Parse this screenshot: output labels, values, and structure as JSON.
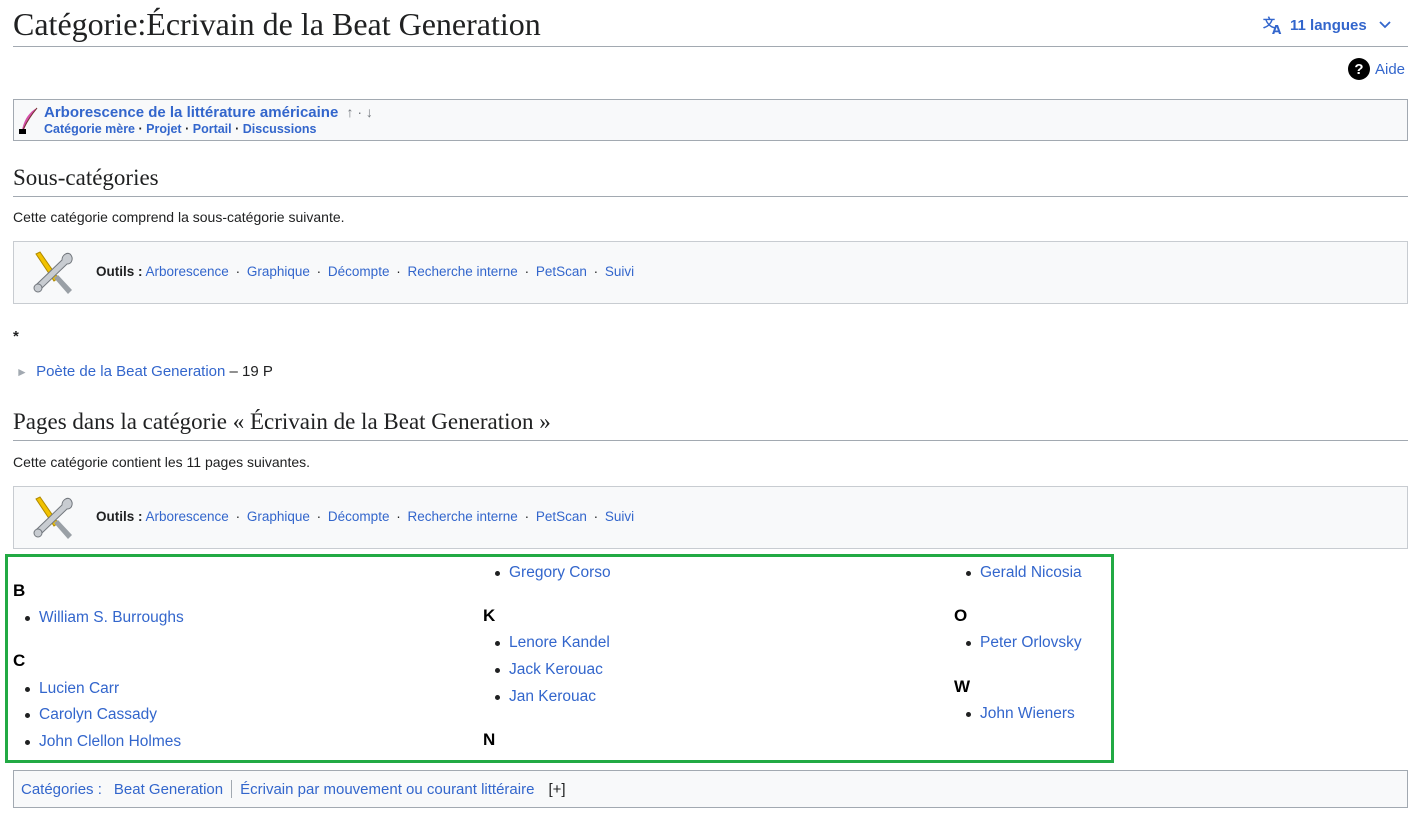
{
  "header": {
    "title": "Catégorie:Écrivain de la Beat Generation",
    "languages_label": "11 langues",
    "help_label": "Aide",
    "help_icon_glyph": "?"
  },
  "tree": {
    "main_link": "Arborescence de la littérature américaine",
    "arrows": "↑ · ↓",
    "sub_links": [
      "Catégorie mère",
      "Projet",
      "Portail",
      "Discussions"
    ],
    "separator": "·"
  },
  "subcategories": {
    "heading": "Sous-catégories",
    "description": "Cette catégorie comprend la sous-catégorie suivante.",
    "star": "*",
    "items": [
      {
        "label": "Poète de la Beat Generation",
        "count": "– 19 P"
      }
    ]
  },
  "tools": {
    "label": "Outils :",
    "links": [
      "Arborescence",
      "Graphique",
      "Décompte",
      "Recherche interne",
      "PetScan",
      "Suivi"
    ],
    "separator": "·"
  },
  "pages": {
    "heading": "Pages dans la catégorie « Écrivain de la Beat Generation »",
    "description": "Cette catégorie contient les 11 pages suivantes.",
    "columns": [
      {
        "groups": [
          {
            "letter": "B",
            "items": [
              "William S. Burroughs"
            ]
          },
          {
            "letter": "C",
            "items": [
              "Lucien Carr",
              "Carolyn Cassady",
              "John Clellon Holmes"
            ]
          }
        ]
      },
      {
        "groups": [
          {
            "letter": "",
            "items": [
              "Gregory Corso"
            ]
          },
          {
            "letter": "K",
            "items": [
              "Lenore Kandel",
              "Jack Kerouac",
              "Jan Kerouac"
            ]
          },
          {
            "letter": "N",
            "items": []
          }
        ]
      },
      {
        "groups": [
          {
            "letter": "",
            "items": [
              "Gerald Nicosia"
            ]
          },
          {
            "letter": "O",
            "items": [
              "Peter Orlovsky"
            ]
          },
          {
            "letter": "W",
            "items": [
              "John Wieners"
            ]
          }
        ]
      }
    ]
  },
  "categories": {
    "label": "Catégories :",
    "links": [
      "Beat Generation",
      "Écrivain par mouvement ou courant littéraire"
    ],
    "expand": "[+]"
  },
  "colors": {
    "link": "#3366cc",
    "highlight": "#22aa44",
    "border": "#a2a9b1"
  }
}
